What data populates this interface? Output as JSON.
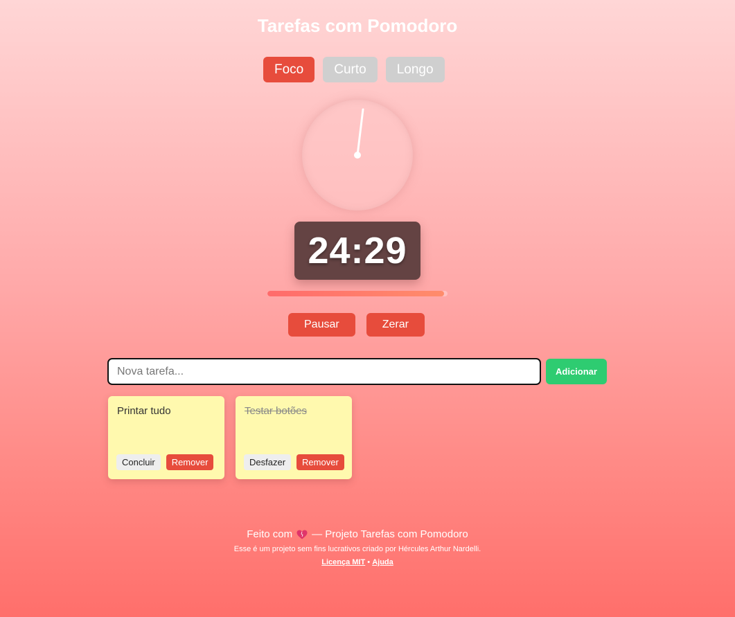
{
  "app": {
    "title": "Tarefas com Pomodoro"
  },
  "modes": [
    {
      "label": "Foco",
      "active": true
    },
    {
      "label": "Curto",
      "active": false
    },
    {
      "label": "Longo",
      "active": false
    }
  ],
  "timer": {
    "display": "24:29",
    "progress": 0.98
  },
  "controls": {
    "pause_label": "Pausar",
    "reset_label": "Zerar"
  },
  "task_form": {
    "placeholder": "Nova tarefa...",
    "value": "",
    "add_label": "Adicionar"
  },
  "tasks": [
    {
      "text": "Printar tudo",
      "done": false,
      "toggle_label": "Concluir",
      "remove_label": "Remover"
    },
    {
      "text": "Testar botões",
      "done": true,
      "toggle_label": "Desfazer",
      "remove_label": "Remover"
    }
  ],
  "footer": {
    "made_with": "Feito com",
    "project": "— Projeto Tarefas com Pomodoro",
    "note": "Esse é um projeto sem fins lucrativos criado por Hércules Arthur Nardelli.",
    "license_link": "Licença MIT",
    "separator": "•",
    "help_link": "Ajuda"
  },
  "colors": {
    "accent": "#e74c3c",
    "success": "#2ecc71",
    "note": "#fff9ae"
  }
}
